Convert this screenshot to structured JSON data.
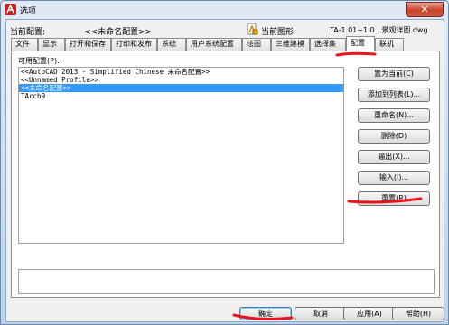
{
  "window": {
    "title": "选项",
    "close_glyph": "✕"
  },
  "header": {
    "current_profile_label": "当前配置:",
    "current_profile_value": "<<未命名配置>>",
    "current_drawing_label": "当前图形:",
    "current_drawing_value": "TA-1.01~1.0...景观详图.dwg"
  },
  "tabs": [
    {
      "label": "文件",
      "active": false
    },
    {
      "label": "显示",
      "active": false
    },
    {
      "label": "打开和保存",
      "active": false
    },
    {
      "label": "打印和发布",
      "active": false
    },
    {
      "label": "系统",
      "active": false
    },
    {
      "label": "用户系统配置",
      "active": false
    },
    {
      "label": "绘图",
      "active": false
    },
    {
      "label": "三维建模",
      "active": false
    },
    {
      "label": "选择集",
      "active": false
    },
    {
      "label": "配置",
      "active": true
    },
    {
      "label": "联机",
      "active": false
    }
  ],
  "profiles": {
    "label": "可用配置(P):",
    "items": [
      {
        "text": "<<AutoCAD 2013 - Simplified Chinese 未命名配置>>",
        "selected": false
      },
      {
        "text": "<<Unnamed Profile>>",
        "selected": false
      },
      {
        "text": "<<未命名配置>>",
        "selected": true
      },
      {
        "text": "TArch9",
        "selected": false
      }
    ]
  },
  "side_buttons": {
    "set_current": "置为当前(C)",
    "add_to_list": "添加到列表(L)...",
    "rename": "重命名(N)...",
    "delete": "删除(D)",
    "export": "输出(X)...",
    "import": "输入(I)...",
    "reset": "重置(R)"
  },
  "bottom_buttons": {
    "ok": "确定",
    "cancel": "取消",
    "apply": "应用(A)",
    "help": "帮助(H)"
  },
  "colors": {
    "accent_mark": "#e8141c",
    "selection": "#3399ff"
  }
}
